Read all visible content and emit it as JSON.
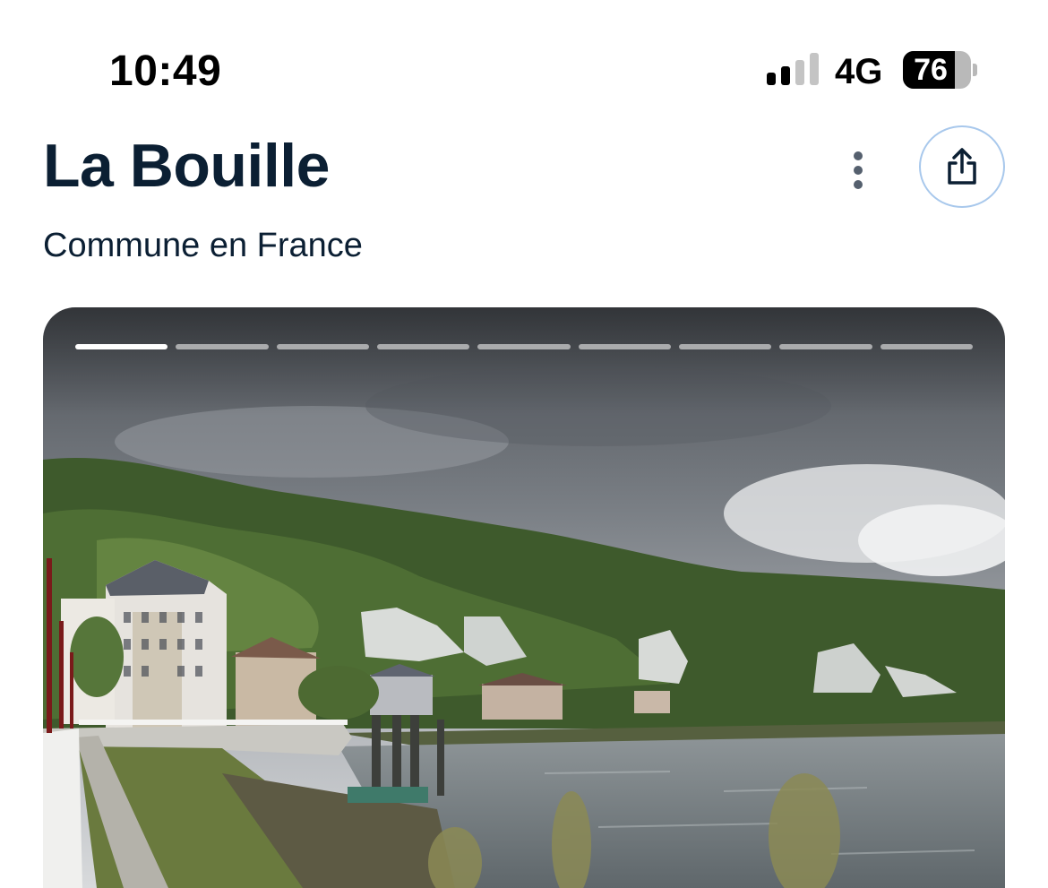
{
  "status_bar": {
    "time": "10:49",
    "network": "4G",
    "battery_level": "76",
    "battery_fraction": 0.76,
    "signal_bars_active": 2,
    "signal_bars_total": 4
  },
  "header": {
    "title": "La Bouille",
    "subtitle": "Commune en France"
  },
  "actions": {
    "more_icon": "more-vertical-icon",
    "share_icon": "share-icon"
  },
  "gallery": {
    "segments_total": 9,
    "active_segment": 1
  },
  "colors": {
    "title": "#0b1f33",
    "share_ring": "#a8c8ec",
    "more_dots": "#55606e"
  }
}
